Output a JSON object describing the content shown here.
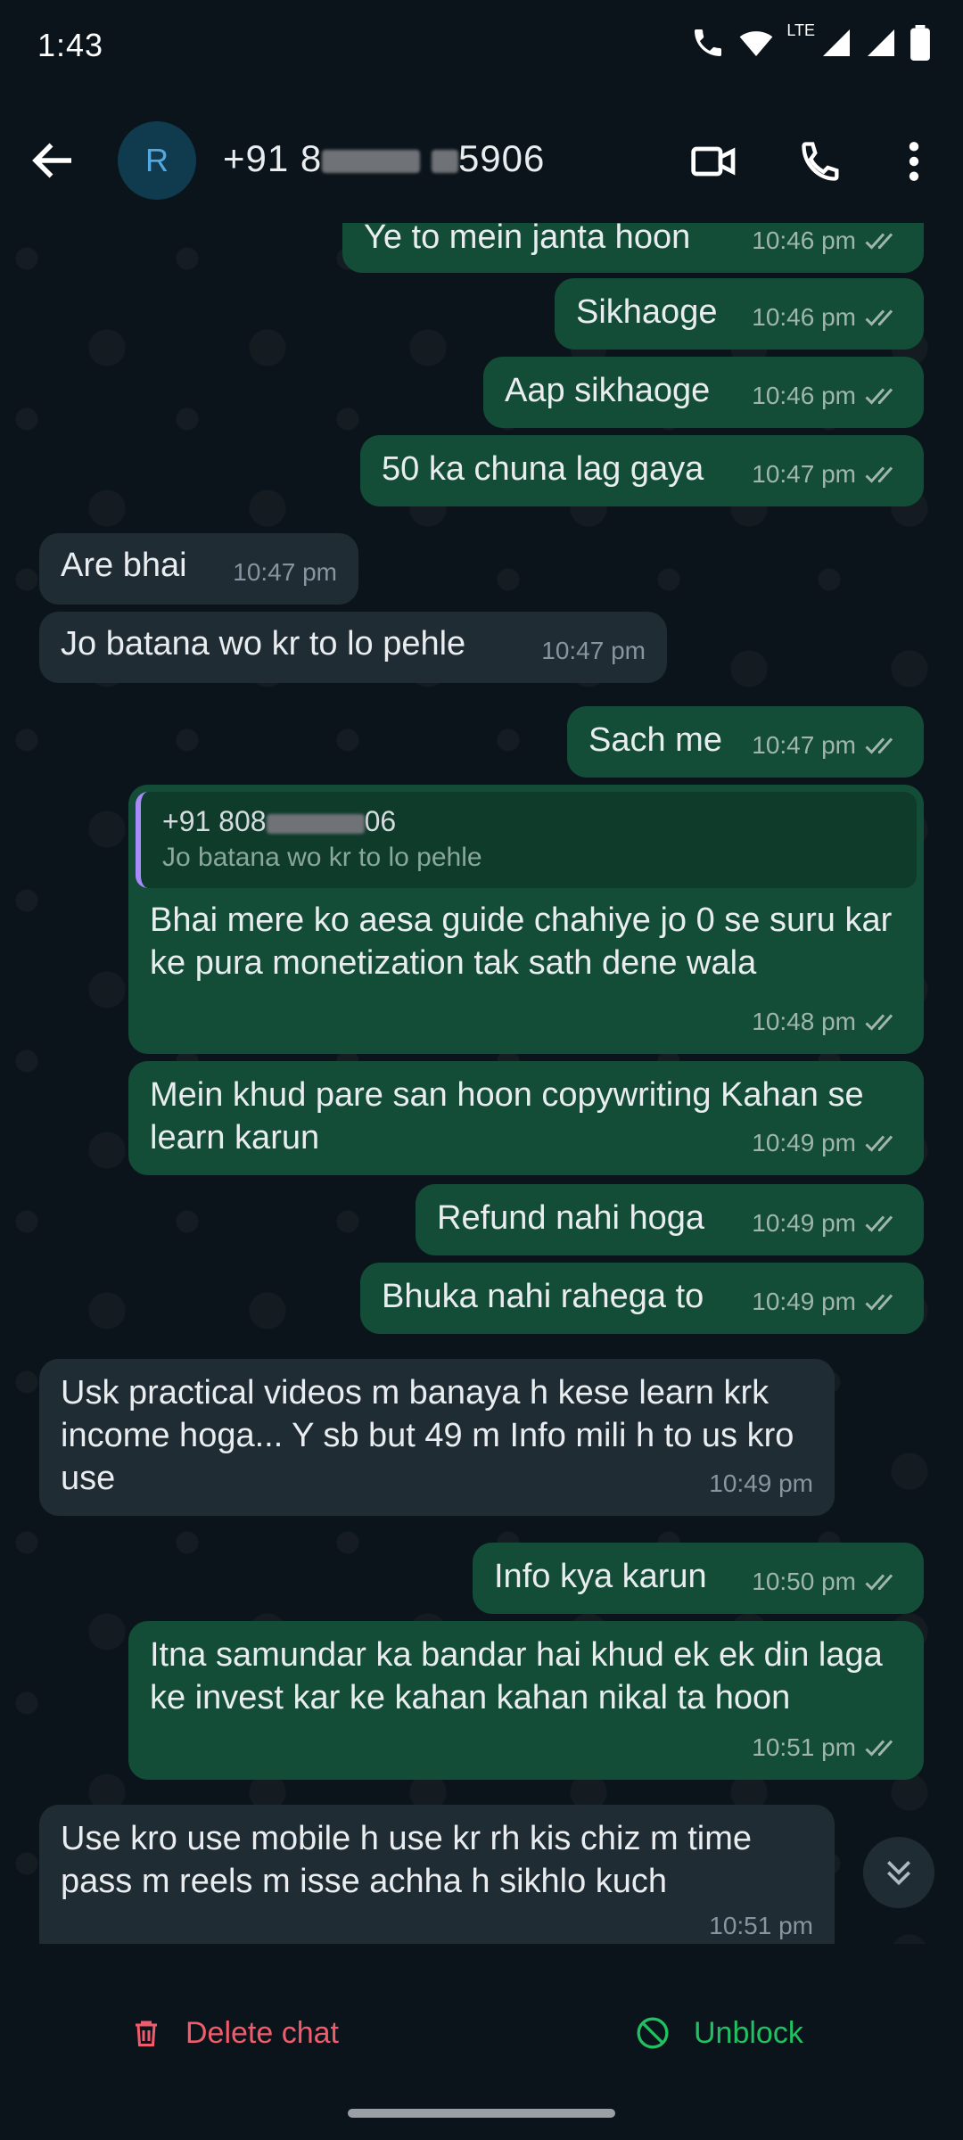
{
  "status_bar": {
    "time": "1:43",
    "network": "LTE"
  },
  "header": {
    "avatar_letter": "R",
    "name_prefix": "+91 8",
    "name_suffix": "5906",
    "icons": [
      "back-arrow-icon",
      "video-call-icon",
      "phone-icon",
      "more-vert-icon"
    ]
  },
  "messages": [
    {
      "dir": "out",
      "text": "Ye to mein janta hoon",
      "time": "10:46 pm"
    },
    {
      "dir": "out",
      "text": "Sikhaoge",
      "time": "10:46 pm"
    },
    {
      "dir": "out",
      "text": "Aap sikhaoge",
      "time": "10:46 pm"
    },
    {
      "dir": "out",
      "text": "50 ka chuna lag gaya",
      "time": "10:47 pm"
    },
    {
      "dir": "in",
      "text": "Are bhai",
      "time": "10:47 pm"
    },
    {
      "dir": "in",
      "text": "Jo batana wo kr to lo pehle",
      "time": "10:47 pm"
    },
    {
      "dir": "out",
      "text": "Sach me",
      "time": "10:47 pm"
    },
    {
      "dir": "out",
      "reply_name": "+91 808",
      "reply_name_suffix": "06",
      "reply_text": "Jo batana wo kr to lo pehle",
      "text": "Bhai mere ko aesa guide chahiye jo 0 se suru kar ke pura monetization tak sath dene wala",
      "time": "10:48 pm"
    },
    {
      "dir": "out",
      "text": "Mein khud pare san hoon copywriting Kahan se learn karun",
      "time": "10:49 pm"
    },
    {
      "dir": "out",
      "text": "Refund nahi hoga",
      "time": "10:49 pm"
    },
    {
      "dir": "out",
      "text": "Bhuka nahi rahega to",
      "time": "10:49 pm"
    },
    {
      "dir": "in",
      "text": "Usk practical videos m banaya h kese learn krk income hoga... Y sb but 49 m Info mili h to us kro use",
      "time": "10:49 pm"
    },
    {
      "dir": "out",
      "text": "Info kya karun",
      "time": "10:50 pm"
    },
    {
      "dir": "out",
      "text": "Itna samundar ka bandar hai khud ek ek din laga ke invest kar ke kahan kahan nikal ta hoon",
      "time": "10:51 pm"
    },
    {
      "dir": "in",
      "text": "Use kro use mobile h use kr rh kis  chiz m time pass m reels m isse achha h sikhlo kuch",
      "time": "10:51 pm"
    }
  ],
  "bottom": {
    "delete_label": "Delete chat",
    "unblock_label": "Unblock"
  },
  "colors": {
    "outgoing": "#144d37",
    "incoming": "#202c33",
    "delete": "#f15c6d",
    "unblock": "#21c063"
  }
}
